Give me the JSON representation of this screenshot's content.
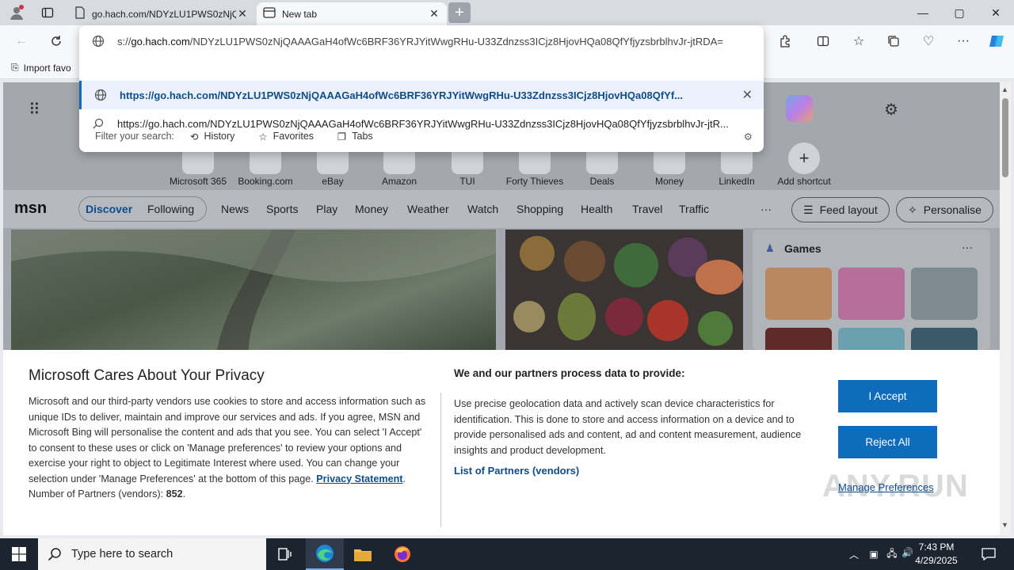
{
  "tabs": [
    {
      "title": "go.hach.com/NDYzLU1PWS0zNjQ",
      "active": false
    },
    {
      "title": "New tab",
      "active": true
    }
  ],
  "window": {
    "minimize": "—",
    "maximize": "▢",
    "close": "✕"
  },
  "address": {
    "prefix": "s://",
    "host": "go.hach.com",
    "path": "/NDYzLU1PWS0zNjQAAAGaH4ofWc6BRF36YRJYitWwgRHu-U33Zdnzss3ICjz8HjovHQa08QfYfjyzsbrblhvJr-jtRDA="
  },
  "suggestions": [
    {
      "text": "https://go.hach.com/NDYzLU1PWS0zNjQAAAGaH4ofWc6BRF36YRJYitWwgRHu-U33Zdnzss3ICjz8HjovHQa08QfYf...",
      "selected": true
    },
    {
      "text": "https://go.hach.com/NDYzLU1PWS0zNjQAAAGaH4ofWc6BRF36YRJYitWwgRHu-U33Zdnzss3ICjz8HjovHQa08QfYfjyzsbrblhvJr-jtR...",
      "selected": false
    }
  ],
  "filter": {
    "label": "Filter your search:",
    "history": "History",
    "favorites": "Favorites",
    "tabs": "Tabs"
  },
  "favbar": {
    "import": "Import favo"
  },
  "shortcuts": [
    "Microsoft 365",
    "Booking.com",
    "eBay",
    "Amazon",
    "TUI",
    "Forty Thieves",
    "Deals",
    "Money",
    "LinkedIn",
    "Add shortcut"
  ],
  "msn": {
    "logo": "msn",
    "nav": [
      "Discover",
      "Following",
      "News",
      "Sports",
      "Play",
      "Money",
      "Weather",
      "Watch",
      "Shopping",
      "Health",
      "Travel",
      "Traffic"
    ],
    "more": "···",
    "feed_layout": "Feed layout",
    "personalise": "Personalise",
    "games_title": "Games",
    "games_more": "···"
  },
  "privacy": {
    "title": "Microsoft Cares About Your Privacy",
    "body": "Microsoft and our third-party vendors use cookies to store and access information such as unique IDs to deliver, maintain and improve our services and ads. If you agree, MSN and Microsoft Bing will personalise the content and ads that you see. You can select 'I Accept' to consent to these uses or click on 'Manage preferences' to review your options and exercise your right to object to Legitimate Interest where used.  You can change your selection under 'Manage Preferences' at the bottom of this page.",
    "privacy_link": "Privacy Statement",
    "partners_label": "Number of Partners (vendors):",
    "partners_count": "852",
    "right_heading": "We and our partners process data to provide:",
    "right_body": "Use precise geolocation data and actively scan device characteristics for identification. This is done to store and access information on a device and to provide personalised ads and content, ad and content measurement, audience insights and product development.",
    "vendors_link": "List of Partners (vendors)",
    "accept": "I Accept",
    "reject": "Reject All",
    "manage": "Manage Preferences"
  },
  "watermark": "ANY.RUN",
  "taskbar": {
    "search_placeholder": "Type here to search",
    "time": "7:43 PM",
    "date": "4/29/2025"
  },
  "colors": {
    "accent": "#0f6cbd",
    "link": "#0f4c8a",
    "taskbar": "#1c2430"
  }
}
